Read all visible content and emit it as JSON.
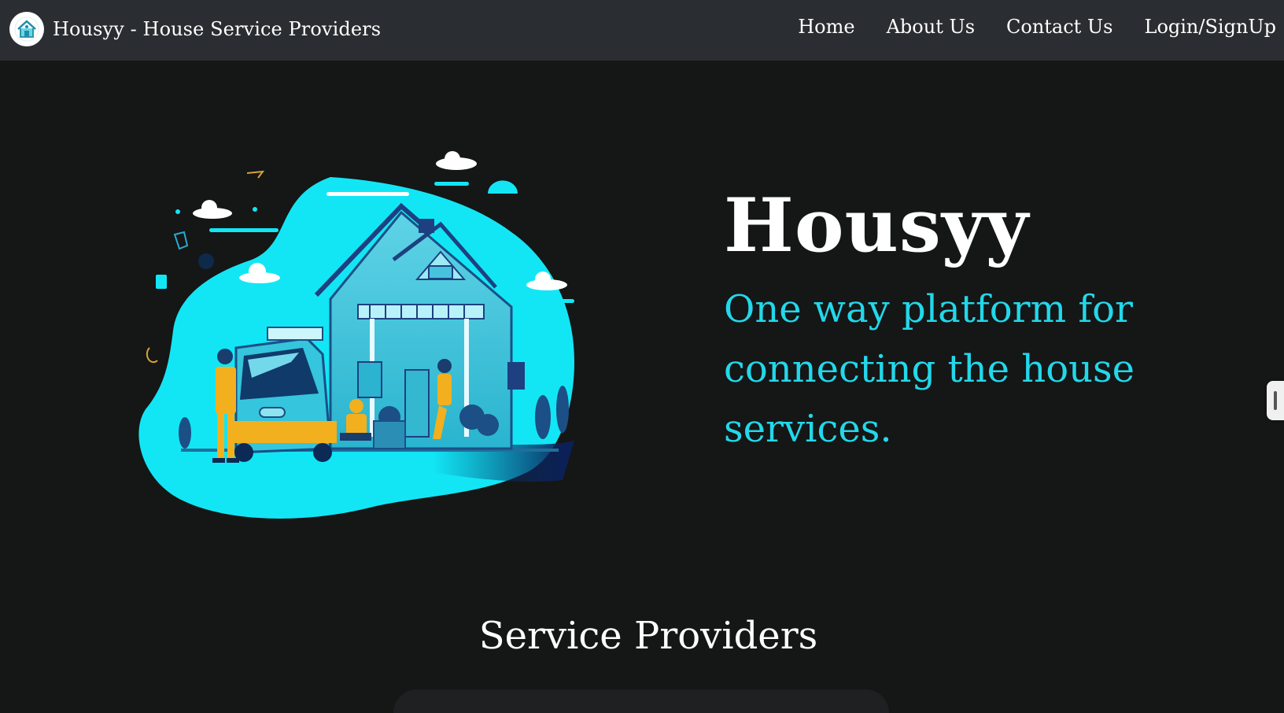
{
  "nav": {
    "brand": "Housyy - House Service Providers",
    "brand_icon": "house-logo-icon",
    "links": [
      "Home",
      "About Us",
      "Contact Us",
      "Login/SignUp"
    ]
  },
  "hero": {
    "title": "Housyy",
    "tagline": "One way platform for connecting the house services.",
    "image": "house-services-illustration"
  },
  "sections": {
    "providers_title": "Service Providers"
  },
  "colors": {
    "nav_bg": "#2a2d31",
    "page_bg": "#151616",
    "accent": "#22d8ea",
    "illustration_cyan": "#12e6f5",
    "illustration_yellow": "#f2b01e"
  }
}
